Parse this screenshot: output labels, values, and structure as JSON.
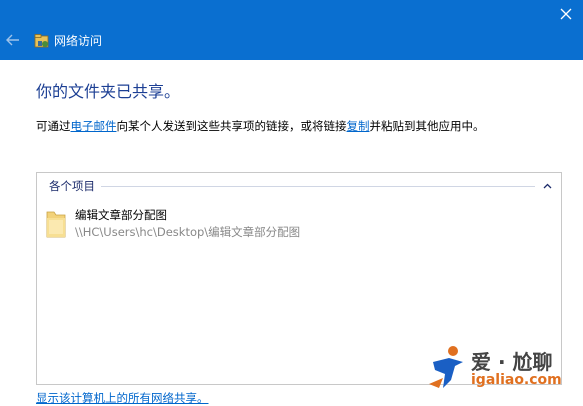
{
  "window": {
    "title": "网络访问",
    "accent_color": "#0a6fd0",
    "close_icon": "close-icon",
    "back_icon": "back-arrow-icon"
  },
  "main": {
    "heading": "你的文件夹已共享。",
    "desc_prefix": "可通过",
    "email_link": "电子邮件",
    "desc_middle": "向某个人发送到这些共享项的链接，或将链接",
    "copy_link": "复制",
    "desc_suffix": "并粘贴到其他应用中。"
  },
  "items_panel": {
    "group_label": "各个项目",
    "items": [
      {
        "name": "编辑文章部分配图",
        "path": "\\\\HC\\Users\\hc\\Desktop\\编辑文章部分配图",
        "icon": "folder-icon"
      }
    ]
  },
  "footer": {
    "link": "显示该计算机上的所有网络共享。"
  },
  "watermark": {
    "line1": "爱 · 尬聊",
    "line2": "igaliao.com"
  }
}
